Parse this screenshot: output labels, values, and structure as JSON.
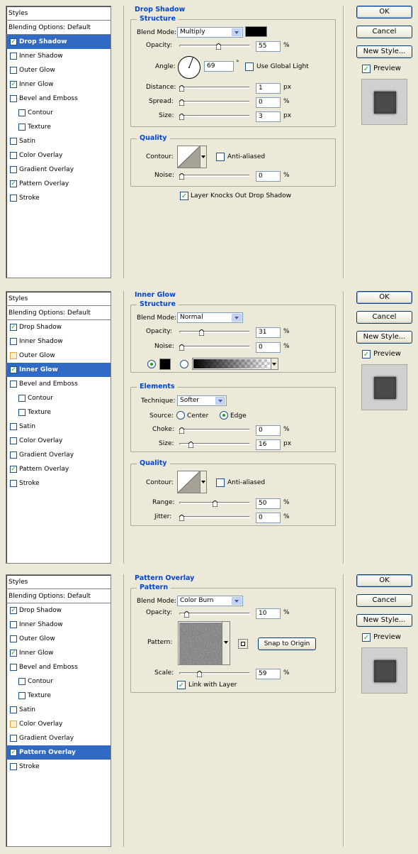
{
  "styles_header": "Styles",
  "blending_options": "Blending Options: Default",
  "buttons": {
    "ok": "OK",
    "cancel": "Cancel",
    "new_style": "New Style...",
    "preview": "Preview"
  },
  "panels": [
    {
      "list": [
        {
          "label": "Drop Shadow",
          "checked": true,
          "selected": true
        },
        {
          "label": "Inner Shadow",
          "checked": false
        },
        {
          "label": "Outer Glow",
          "checked": false
        },
        {
          "label": "Inner Glow",
          "checked": true
        },
        {
          "label": "Bevel and Emboss",
          "checked": false
        },
        {
          "label": "Contour",
          "checked": false,
          "sub": true
        },
        {
          "label": "Texture",
          "checked": false,
          "sub": true
        },
        {
          "label": "Satin",
          "checked": false
        },
        {
          "label": "Color Overlay",
          "checked": false
        },
        {
          "label": "Gradient Overlay",
          "checked": false
        },
        {
          "label": "Pattern Overlay",
          "checked": true
        },
        {
          "label": "Stroke",
          "checked": false
        }
      ],
      "title": "Drop Shadow",
      "structure": {
        "title": "Structure",
        "blend_mode_label": "Blend Mode:",
        "blend_mode": "Multiply",
        "opacity_label": "Opacity:",
        "opacity": "55",
        "angle_label": "Angle:",
        "angle": "69",
        "use_global_light": "Use Global Light",
        "distance_label": "Distance:",
        "distance": "1",
        "spread_label": "Spread:",
        "spread": "0",
        "size_label": "Size:",
        "size": "3"
      },
      "quality": {
        "title": "Quality",
        "contour_label": "Contour:",
        "anti_aliased": "Anti-aliased",
        "noise_label": "Noise:",
        "noise": "0",
        "knockout": "Layer Knocks Out Drop Shadow"
      }
    },
    {
      "list": [
        {
          "label": "Drop Shadow",
          "checked": true
        },
        {
          "label": "Inner Shadow",
          "checked": false
        },
        {
          "label": "Outer Glow",
          "checked": false,
          "hl": true
        },
        {
          "label": "Inner Glow",
          "checked": true,
          "selected": true
        },
        {
          "label": "Bevel and Emboss",
          "checked": false
        },
        {
          "label": "Contour",
          "checked": false,
          "sub": true
        },
        {
          "label": "Texture",
          "checked": false,
          "sub": true
        },
        {
          "label": "Satin",
          "checked": false
        },
        {
          "label": "Color Overlay",
          "checked": false
        },
        {
          "label": "Gradient Overlay",
          "checked": false
        },
        {
          "label": "Pattern Overlay",
          "checked": true
        },
        {
          "label": "Stroke",
          "checked": false
        }
      ],
      "title": "Inner Glow",
      "structure": {
        "title": "Structure",
        "blend_mode_label": "Blend Mode:",
        "blend_mode": "Normal",
        "opacity_label": "Opacity:",
        "opacity": "31",
        "noise_label": "Noise:",
        "noise": "0"
      },
      "elements": {
        "title": "Elements",
        "technique_label": "Technique:",
        "technique": "Softer",
        "source_label": "Source:",
        "center": "Center",
        "edge": "Edge",
        "choke_label": "Choke:",
        "choke": "0",
        "size_label": "Size:",
        "size": "16"
      },
      "quality": {
        "title": "Quality",
        "contour_label": "Contour:",
        "anti_aliased": "Anti-aliased",
        "range_label": "Range:",
        "range": "50",
        "jitter_label": "Jitter:",
        "jitter": "0"
      }
    },
    {
      "list": [
        {
          "label": "Drop Shadow",
          "checked": true
        },
        {
          "label": "Inner Shadow",
          "checked": false
        },
        {
          "label": "Outer Glow",
          "checked": false
        },
        {
          "label": "Inner Glow",
          "checked": true
        },
        {
          "label": "Bevel and Emboss",
          "checked": false
        },
        {
          "label": "Contour",
          "checked": false,
          "sub": true
        },
        {
          "label": "Texture",
          "checked": false,
          "sub": true
        },
        {
          "label": "Satin",
          "checked": false
        },
        {
          "label": "Color Overlay",
          "checked": false,
          "hl": true
        },
        {
          "label": "Gradient Overlay",
          "checked": false
        },
        {
          "label": "Pattern Overlay",
          "checked": true,
          "selected": true
        },
        {
          "label": "Stroke",
          "checked": false
        }
      ],
      "title": "Pattern Overlay",
      "pattern": {
        "title": "Pattern",
        "blend_mode_label": "Blend Mode:",
        "blend_mode": "Color Burn",
        "opacity_label": "Opacity:",
        "opacity": "10",
        "pattern_label": "Pattern:",
        "snap": "Snap to Origin",
        "scale_label": "Scale:",
        "scale": "59",
        "link": "Link with Layer"
      }
    }
  ]
}
